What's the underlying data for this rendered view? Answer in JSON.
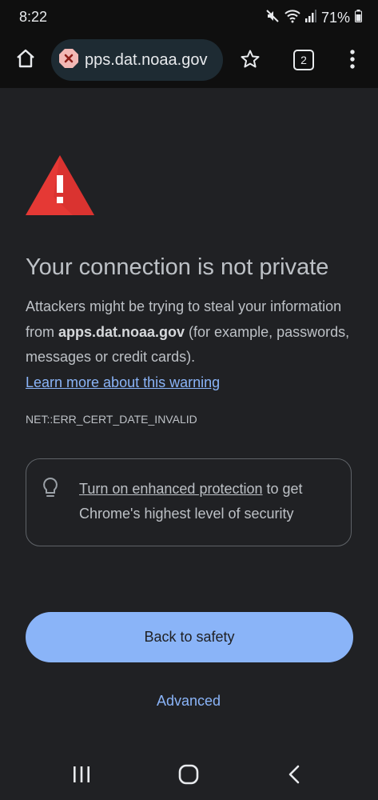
{
  "status_bar": {
    "time": "8:22",
    "battery": "71%",
    "icons": [
      "mute-icon",
      "wifi-icon",
      "signal-icon",
      "battery-icon"
    ]
  },
  "toolbar": {
    "url": "apps.dat.noaa.gov",
    "url_visible": "pps.dat.noaa.gov",
    "tab_count": "2",
    "icons": [
      "home-icon",
      "not-secure-icon",
      "star-icon",
      "tabs-icon",
      "more-vert-icon"
    ]
  },
  "content": {
    "headline": "Your connection is not private",
    "body_prefix": "Attackers might be trying to steal your information from ",
    "body_domain": "apps.dat.noaa.gov",
    "body_suffix": " (for example, passwords, messages or credit cards).",
    "learn_more": "Learn more about this warning",
    "error_code": "NET::ERR_CERT_DATE_INVALID",
    "enhanced_link": "Turn on enhanced protection",
    "enhanced_rest": " to get Chrome's highest level of security",
    "back_button": "Back to safety",
    "advanced_button": "Advanced"
  },
  "nav_bar": {
    "icons": [
      "recent-apps-icon",
      "home-nav-icon",
      "back-nav-icon"
    ]
  },
  "colors": {
    "background": "#202124",
    "toolbar": "#0f0f0f",
    "omnibox": "#1e2b33",
    "accent": "#8ab4f8",
    "warning_red": "#e53935",
    "text": "#bdc1c6"
  }
}
